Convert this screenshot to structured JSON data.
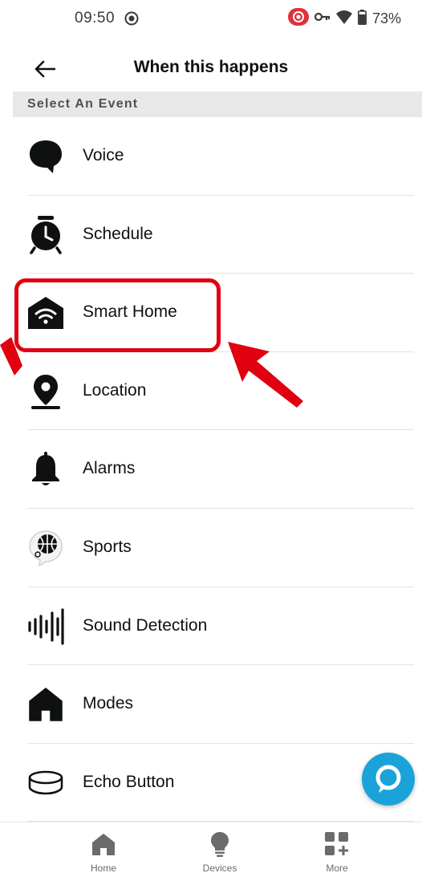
{
  "status_bar": {
    "time": "09:50",
    "battery": "73%"
  },
  "header": {
    "title": "When this happens"
  },
  "section": {
    "label": "Select An Event"
  },
  "events": [
    {
      "label": "Voice",
      "icon": "speech-bubble-icon"
    },
    {
      "label": "Schedule",
      "icon": "alarm-clock-icon"
    },
    {
      "label": "Smart Home",
      "icon": "smart-home-icon"
    },
    {
      "label": "Location",
      "icon": "location-pin-icon"
    },
    {
      "label": "Alarms",
      "icon": "bell-icon"
    },
    {
      "label": "Sports",
      "icon": "basketball-icon"
    },
    {
      "label": "Sound Detection",
      "icon": "sound-wave-icon"
    },
    {
      "label": "Modes",
      "icon": "house-icon"
    },
    {
      "label": "Echo Button",
      "icon": "echo-button-icon"
    }
  ],
  "bottom_nav": [
    {
      "label": "Home",
      "icon": "home-icon"
    },
    {
      "label": "Devices",
      "icon": "lightbulb-icon"
    },
    {
      "label": "More",
      "icon": "more-grid-icon"
    }
  ],
  "colors": {
    "highlight": "#e0000f",
    "alexa": "#1aa3d9",
    "section_bg": "#e8e8e8"
  }
}
